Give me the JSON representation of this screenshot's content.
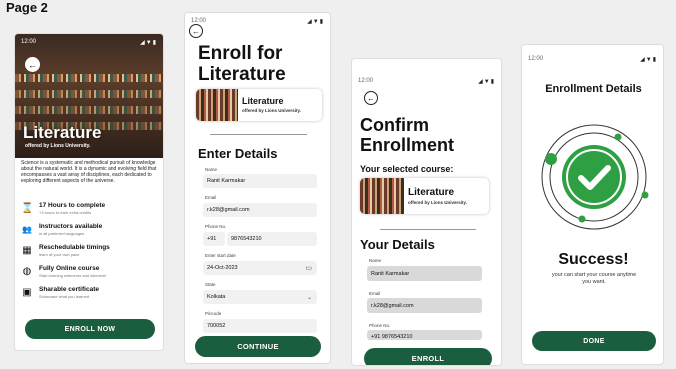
{
  "page_title": "Page 2",
  "status_time": "12:00",
  "status_icons": "◢▼▮",
  "screen1": {
    "hero_title": "Literature",
    "hero_sub": "offered by Lions University.",
    "description": "Science is a systematic and methodical pursuit of knowledge about the natural world. It is a dynamic and evolving field that encompasses a vast array of disciplines, each dedicated to exploring different aspects of the universe.",
    "features": [
      {
        "icon": "hourglass-icon",
        "glyph": "⌛",
        "title": "17 Hours to complete",
        "sub": "+3 hours to earn extra credits"
      },
      {
        "icon": "instructors-icon",
        "glyph": "👥",
        "title": "Instructors available",
        "sub": "in all preferred languages"
      },
      {
        "icon": "calendar-icon",
        "glyph": "▦",
        "title": "Reschedulable timings",
        "sub": "learn at your own pace"
      },
      {
        "icon": "globe-icon",
        "glyph": "◍",
        "title": "Fully Online course",
        "sub": "Start learning whenever and wherever"
      },
      {
        "icon": "certificate-icon",
        "glyph": "▣",
        "title": "Sharable certificate",
        "sub": "Showcase what you learned"
      }
    ],
    "button": "ENROLL NOW"
  },
  "screen2": {
    "title": "Enroll for Literature",
    "course_title": "Literature",
    "course_sub": "offered by Lions University.",
    "section": "Enter Details",
    "fields": {
      "name_label": "Name",
      "name": "Ranit Karmakar",
      "email_label": "Email",
      "email": "r.k28@gmail.com",
      "phone_label": "Phone No.",
      "phone_code": "+91",
      "phone": "9876543210",
      "date_label": "Enter start date",
      "date": "24-Oct-2023",
      "state_label": "State",
      "state": "Kolkata",
      "pincode_label": "Pincode",
      "pincode": "700052"
    },
    "button": "CONTINUE"
  },
  "screen3": {
    "title": "Confirm Enrollment",
    "selected_label": "Your selected course:",
    "course_title": "Literature",
    "course_sub": "offered by Lions University.",
    "section": "Your Details",
    "name_label": "Name",
    "name": "Ranit Karmakar",
    "email_label": "Email",
    "email": "r.k28@gmail.com",
    "phone_label": "Phone No.",
    "phone": "+91  9876543210",
    "button": "ENROLL"
  },
  "screen4": {
    "title": "Enrollment Details",
    "success": "Success!",
    "message": "your can start your course anytime you want.",
    "button": "DONE"
  },
  "colors": {
    "accent": "#1b5e3f",
    "success": "#2ea043"
  }
}
